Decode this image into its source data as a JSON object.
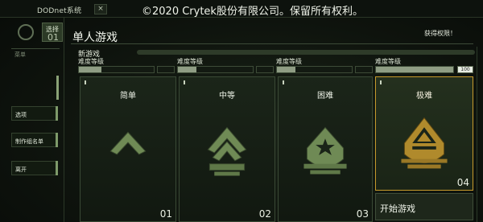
{
  "window": {
    "title": "DODnet系统",
    "close_glyph": "×"
  },
  "copyright": "©2020 Crytek股份有限公司。保留所有权利。",
  "sidebar": {
    "select_label": "选择",
    "select_number": "01",
    "header": "菜单",
    "items": [
      {
        "label": "选项"
      },
      {
        "label": "制作组名单"
      },
      {
        "label": "离开"
      }
    ]
  },
  "panel": {
    "title": "单人游戏",
    "unlock_label": "获得权限！",
    "section_label": "新游戏"
  },
  "difficulty_bars": [
    {
      "label": "难度等级",
      "fill": 0.3
    },
    {
      "label": "难度等级",
      "fill": 0.25
    },
    {
      "label": "难度等级",
      "fill": 0.25
    },
    {
      "label": "难度等级",
      "fill": 1.0,
      "value": "100"
    }
  ],
  "cards": [
    {
      "name": "简单",
      "number": "01",
      "icon": "rank-chevron-icon",
      "selected": false
    },
    {
      "name": "中等",
      "number": "02",
      "icon": "rank-double-chevron-icon",
      "selected": false
    },
    {
      "name": "困难",
      "number": "03",
      "icon": "rank-star-shield-icon",
      "selected": false
    },
    {
      "name": "极难",
      "number": "04",
      "icon": "rank-emblem-icon",
      "selected": true
    }
  ],
  "start_button": "开始游戏",
  "colors": {
    "accent_gold": "#c79a2c",
    "icon_green": "#6f8a55",
    "icon_gold": "#b08a2c"
  }
}
